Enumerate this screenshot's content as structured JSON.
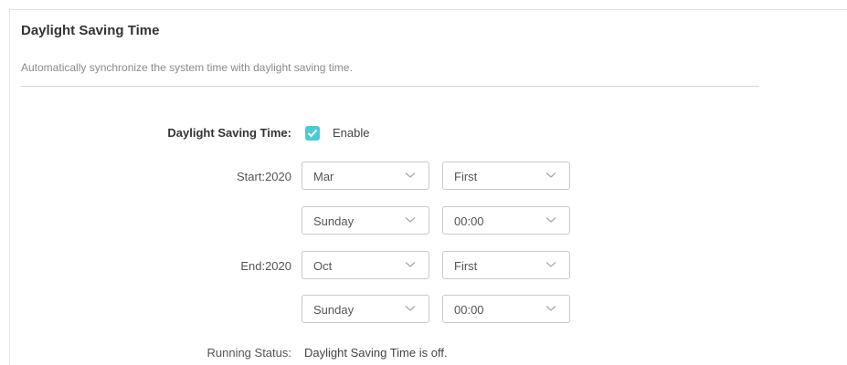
{
  "section": {
    "title": "Daylight Saving Time",
    "description": "Automatically synchronize the system time with daylight saving time."
  },
  "dst": {
    "label": "Daylight Saving Time:",
    "enable_label": "Enable",
    "enabled": true
  },
  "start": {
    "label": "Start:2020",
    "month": "Mar",
    "week": "First",
    "day": "Sunday",
    "time": "00:00"
  },
  "end": {
    "label": "End:2020",
    "month": "Oct",
    "week": "First",
    "day": "Sunday",
    "time": "00:00"
  },
  "status": {
    "label": "Running Status:",
    "value": "Daylight Saving Time is off."
  },
  "colors": {
    "accent": "#4acbd6"
  }
}
